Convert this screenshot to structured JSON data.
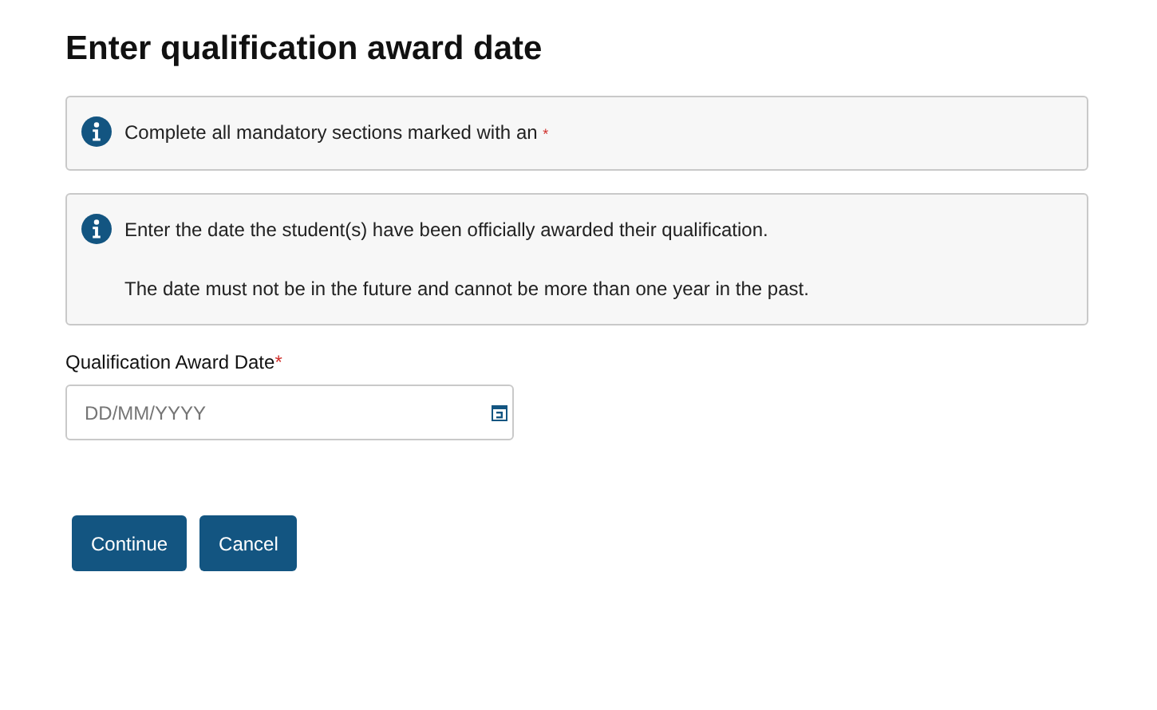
{
  "title": "Enter qualification award date",
  "notices": [
    {
      "paragraphs": [
        "Complete all mandatory sections marked with an"
      ],
      "required_mark": "*"
    },
    {
      "paragraphs": [
        "Enter the date the student(s) have been officially awarded their qualification.",
        "The date must not be in the future and cannot be more than one year in the past."
      ]
    }
  ],
  "field": {
    "label": "Qualification Award Date",
    "required_mark": "*",
    "placeholder": "DD/MM/YYYY"
  },
  "buttons": [
    "Continue",
    "Cancel"
  ]
}
